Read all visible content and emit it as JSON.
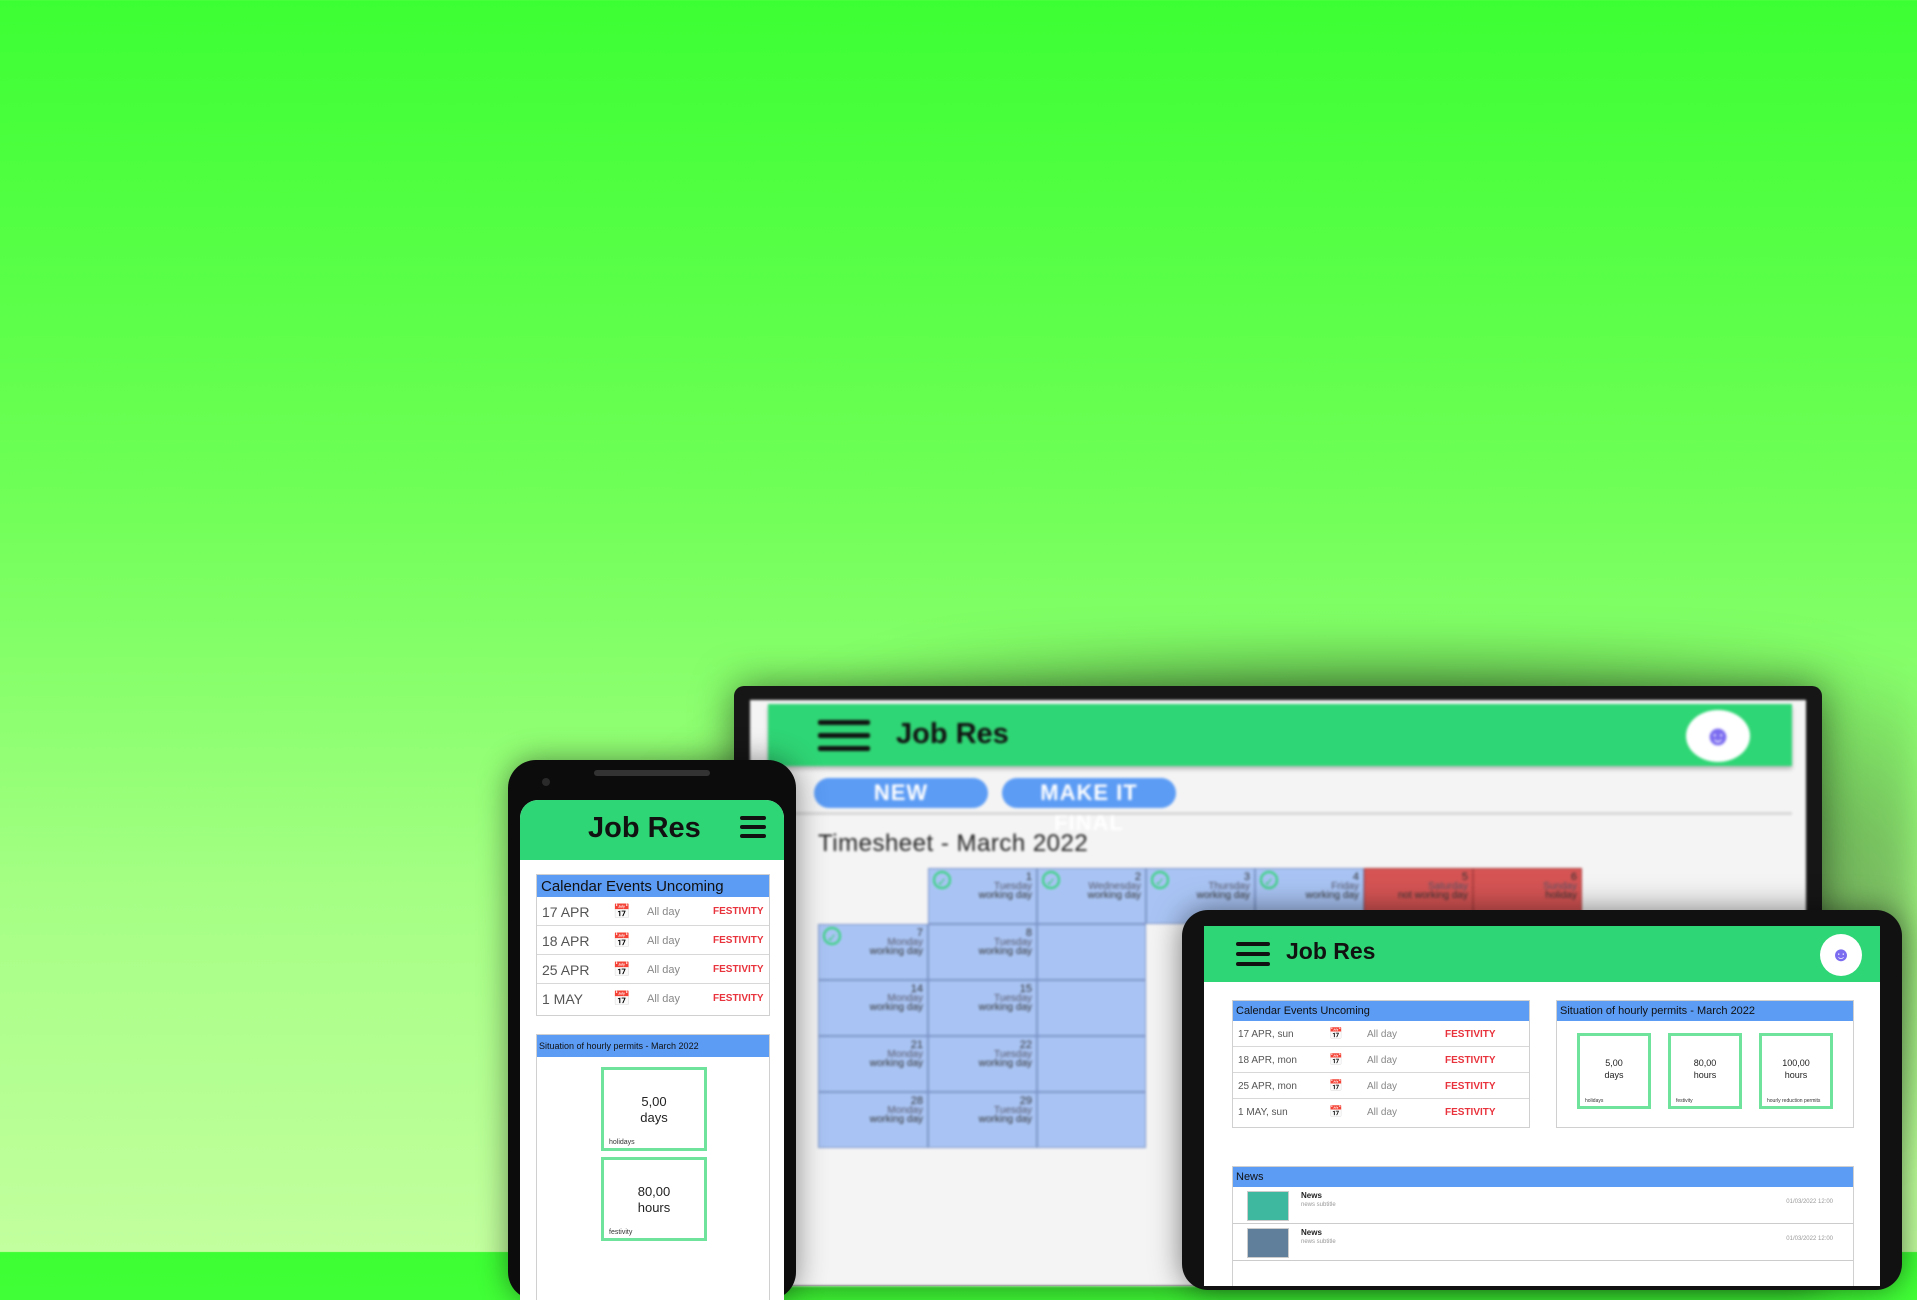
{
  "app_name": "Job Res",
  "monitor": {
    "buttons": {
      "new": "NEW",
      "make_final": "MAKE IT FINAL"
    },
    "sheet_title": "Timesheet - March 2022",
    "calendar": {
      "week1": [
        {
          "num": "1",
          "day": "Tuesday",
          "status": "working day",
          "checked": true
        },
        {
          "num": "2",
          "day": "Wednesday",
          "status": "working day",
          "checked": true
        },
        {
          "num": "3",
          "day": "Thursday",
          "status": "working day",
          "checked": true
        },
        {
          "num": "4",
          "day": "Friday",
          "status": "working day",
          "checked": true
        },
        {
          "num": "5",
          "day": "Saturday",
          "status": "not working day",
          "checked": false
        },
        {
          "num": "6",
          "day": "Sunday",
          "status": "holiday",
          "checked": false
        }
      ],
      "rows": [
        [
          {
            "num": "7",
            "day": "Monday",
            "status": "working day",
            "checked": true
          },
          {
            "num": "8",
            "day": "Tuesday",
            "status": "working day"
          }
        ],
        [
          {
            "num": "14",
            "day": "Monday",
            "status": "working day"
          },
          {
            "num": "15",
            "day": "Tuesday",
            "status": "working day"
          }
        ],
        [
          {
            "num": "21",
            "day": "Monday",
            "status": "working day"
          },
          {
            "num": "22",
            "day": "Tuesday",
            "status": "working day"
          }
        ],
        [
          {
            "num": "28",
            "day": "Monday",
            "status": "working day"
          },
          {
            "num": "29",
            "day": "Tuesday",
            "status": "working day"
          }
        ]
      ]
    }
  },
  "phone": {
    "events_title": "Calendar Events Uncoming",
    "events": [
      {
        "date": "17 APR",
        "time": "All day",
        "type": "FESTIVITY"
      },
      {
        "date": "18 APR",
        "time": "All day",
        "type": "FESTIVITY"
      },
      {
        "date": "25 APR",
        "time": "All day",
        "type": "FESTIVITY"
      },
      {
        "date": "1 MAY",
        "time": "All day",
        "type": "FESTIVITY"
      }
    ],
    "permits_title": "Situation of hourly permits - March 2022",
    "permits": [
      {
        "value": "5,00",
        "unit": "days",
        "label": "holidays"
      },
      {
        "value": "80,00",
        "unit": "hours",
        "label": "festivity"
      }
    ]
  },
  "tablet": {
    "events_title": "Calendar Events Uncoming",
    "events": [
      {
        "date": "17 APR, sun",
        "time": "All day",
        "type": "FESTIVITY"
      },
      {
        "date": "18 APR, mon",
        "time": "All day",
        "type": "FESTIVITY"
      },
      {
        "date": "25 APR, mon",
        "time": "All day",
        "type": "FESTIVITY"
      },
      {
        "date": "1 MAY, sun",
        "time": "All day",
        "type": "FESTIVITY"
      }
    ],
    "permits_title": "Situation of hourly permits - March 2022",
    "permits": [
      {
        "value": "5,00",
        "unit": "days",
        "label": "holidays"
      },
      {
        "value": "80,00",
        "unit": "hours",
        "label": "festivity"
      },
      {
        "value": "100,00",
        "unit": "hours",
        "label": "hourly reduction permits"
      }
    ],
    "news_title": "News",
    "news": [
      {
        "title": "News",
        "subtitle": "news subtitle",
        "date": "01/03/2022 12:00"
      },
      {
        "title": "News",
        "subtitle": "news subtitle",
        "date": "01/03/2022 12:00"
      }
    ]
  },
  "colors": {
    "green": "#2fd675",
    "blue": "#5c9cf5",
    "festivity": "#e8323c",
    "red_day": "#d65454"
  },
  "icons": {
    "menu": "hamburger-icon",
    "user": "user-icon",
    "calendar": "calendar-icon",
    "check": "check-circle-icon"
  }
}
